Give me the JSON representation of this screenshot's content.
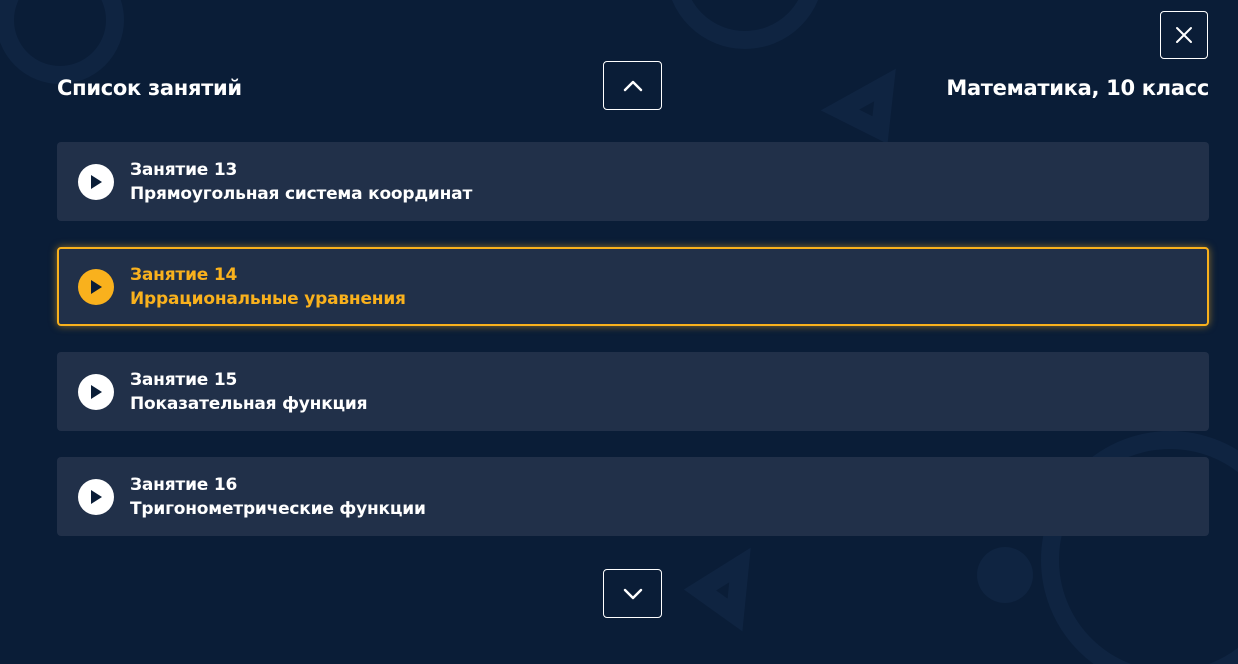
{
  "header": {
    "title": "Список занятий",
    "subject": "Математика, 10 класс"
  },
  "controls": {
    "close_icon": "close-icon",
    "up_icon": "chevron-up-icon",
    "down_icon": "chevron-down-icon"
  },
  "lessons": [
    {
      "number": "Занятие 13",
      "topic": "Прямоугольная система координат",
      "active": false
    },
    {
      "number": "Занятие 14",
      "topic": "Иррациональные уравнения",
      "active": true
    },
    {
      "number": "Занятие 15",
      "topic": "Показательная функция",
      "active": false
    },
    {
      "number": "Занятие 16",
      "topic": "Тригонометрические функции",
      "active": false
    }
  ],
  "colors": {
    "background": "#0a1d37",
    "card": "#213049",
    "accent": "#f9b11d",
    "text": "#ffffff"
  }
}
